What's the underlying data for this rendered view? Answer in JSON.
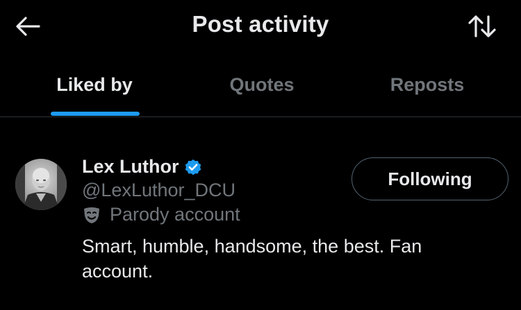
{
  "header": {
    "title": "Post activity",
    "back_icon": "arrow-left-icon",
    "sort_icon": "sort-arrows-icon"
  },
  "tabs": [
    {
      "label": "Liked by",
      "active": true
    },
    {
      "label": "Quotes",
      "active": false
    },
    {
      "label": "Reposts",
      "active": false
    }
  ],
  "user": {
    "display_name": "Lex Luthor",
    "handle": "@LexLuthor_DCU",
    "verified": true,
    "parody_label": "Parody account",
    "bio": "Smart, humble, handsome, the best. Fan account.",
    "follow_button_label": "Following"
  },
  "colors": {
    "background": "#000000",
    "text_primary": "#e7e9ea",
    "text_secondary": "#71767b",
    "accent": "#1d9bf0",
    "divider": "#2f3336"
  }
}
